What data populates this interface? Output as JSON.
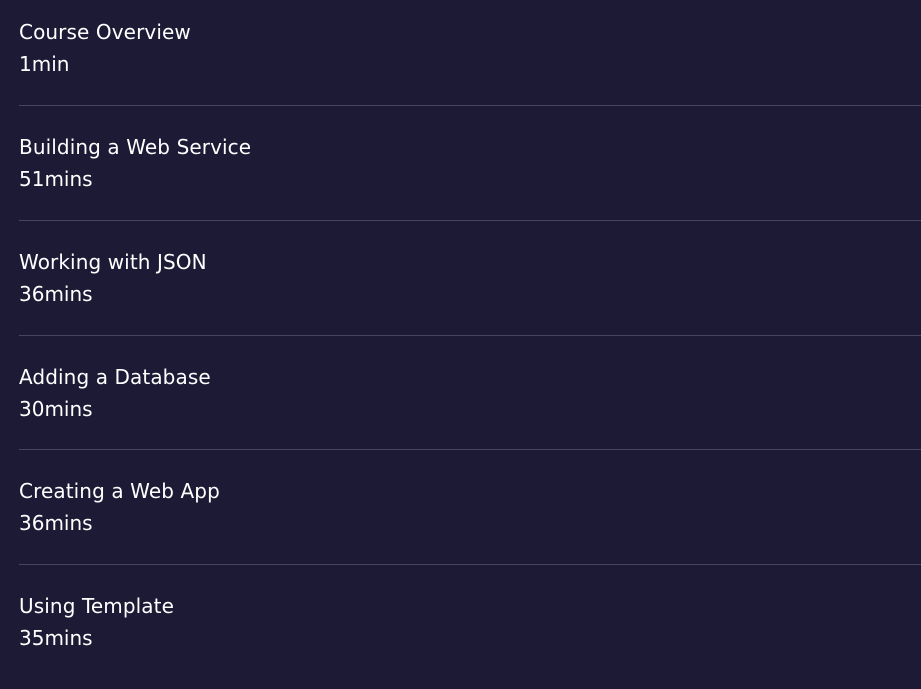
{
  "modules": [
    {
      "title": "Course Overview",
      "duration": "1min"
    },
    {
      "title": "Building a Web Service",
      "duration": "51mins"
    },
    {
      "title": "Working with JSON",
      "duration": "36mins"
    },
    {
      "title": "Adding a Database",
      "duration": "30mins"
    },
    {
      "title": "Creating a Web App",
      "duration": "36mins"
    },
    {
      "title": "Using Template",
      "duration": "35mins"
    }
  ],
  "colors": {
    "background": "#1c1a35",
    "divider": "#474463",
    "text": "#ffffff"
  }
}
